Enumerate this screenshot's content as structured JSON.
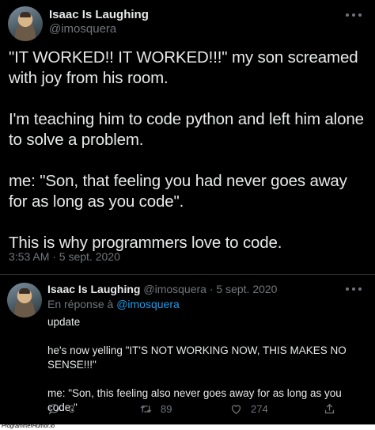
{
  "tweet": {
    "author_name": "Isaac Is Laughing",
    "author_handle": "@imosquera",
    "text": "\"IT WORKED!! IT WORKED!!!\" my son screamed with joy from his room.\n\nI'm teaching him to code python and left him alone to solve a problem.\n\nme: \"Son, that feeling you had never goes away for as long as you code\".\n\nThis is why programmers love to code.",
    "timestamp": "3:53 AM · 5 sept. 2020"
  },
  "reply": {
    "author_name": "Isaac Is Laughing",
    "author_handle": "@imosquera",
    "date": "5 sept. 2020",
    "replying_prefix": "En réponse à",
    "replying_to": "@imosquera",
    "text": "update\n\nhe's now yelling \"IT'S NOT WORKING NOW, THIS MAKES NO SENSE!!!\"\n\nme: \"Son, this feeling also never goes away for as long as you code.\"",
    "actions": {
      "reply_count": "3",
      "retweet_count": "89",
      "like_count": "274"
    }
  },
  "icons": {
    "more": "more-horizontal-icon",
    "reply": "comment-icon",
    "retweet": "retweet-icon",
    "like": "heart-icon",
    "share": "share-icon"
  },
  "colors": {
    "background": "#000000",
    "text": "#e7e9ea",
    "secondary": "#71767b",
    "link": "#1d9bf0",
    "divider": "#2f3336"
  },
  "watermark": "ProgrammerHumor.io"
}
